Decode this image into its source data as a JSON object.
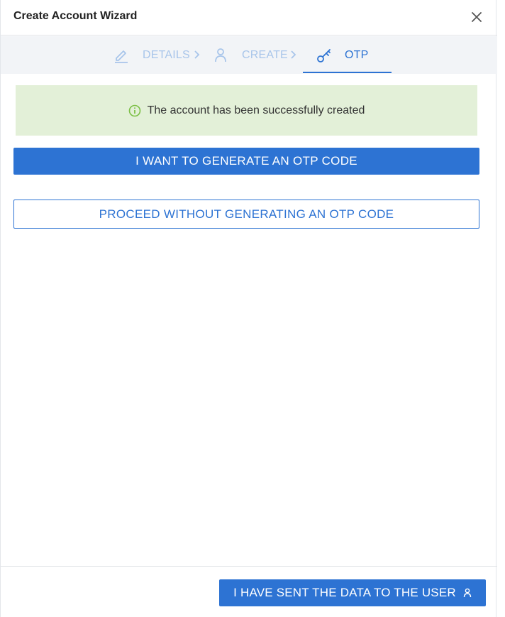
{
  "dialog": {
    "title": "Create Account Wizard"
  },
  "stepper": {
    "steps": [
      {
        "label": "DETAILS",
        "icon": "pencil-icon",
        "state": "inactive"
      },
      {
        "label": "CREATE",
        "icon": "user-icon",
        "state": "inactive"
      },
      {
        "label": "OTP",
        "icon": "key-icon",
        "state": "active"
      }
    ]
  },
  "alert": {
    "message": "The account has been successfully created",
    "icon": "info-circle-icon",
    "color": "#e3f0d8"
  },
  "actions": {
    "generate_otp_label": "I WANT TO GENERATE AN OTP CODE",
    "proceed_without_label": "PROCEED WITHOUT GENERATING AN OTP CODE"
  },
  "footer": {
    "sent_label": "I HAVE SENT THE DATA TO THE USER",
    "sent_icon": "user-icon"
  },
  "colors": {
    "accent": "#2d73d3",
    "inactive_step": "#a8c5ea",
    "success": "#7bbf44"
  }
}
